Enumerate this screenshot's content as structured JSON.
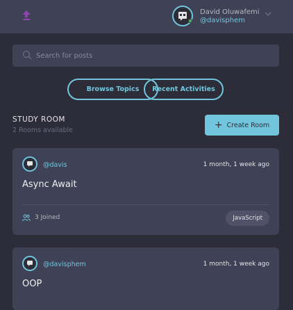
{
  "header": {
    "user": {
      "name": "David Oluwafemi",
      "handle": "@davisphem"
    }
  },
  "search": {
    "placeholder": "Search for posts"
  },
  "filters": {
    "browse_topics": "Browse Topics",
    "recent_activities": "Recent Activities"
  },
  "rooms_section": {
    "title": "STUDY ROOM",
    "count_text": "2 Rooms available",
    "create_label": "Create Room"
  },
  "rooms": [
    {
      "host": "@davis",
      "time": "1 month, 1 week ago",
      "title": "Async Await",
      "joined": "3 Joined",
      "topic": "JavaScript"
    },
    {
      "host": "@davisphem",
      "time": "1 month, 1 week ago",
      "title": "OOP"
    }
  ],
  "colors": {
    "accent": "#71c6dd",
    "background": "#2d2d39",
    "card": "#3f4156",
    "logo": "#8e44ad"
  }
}
